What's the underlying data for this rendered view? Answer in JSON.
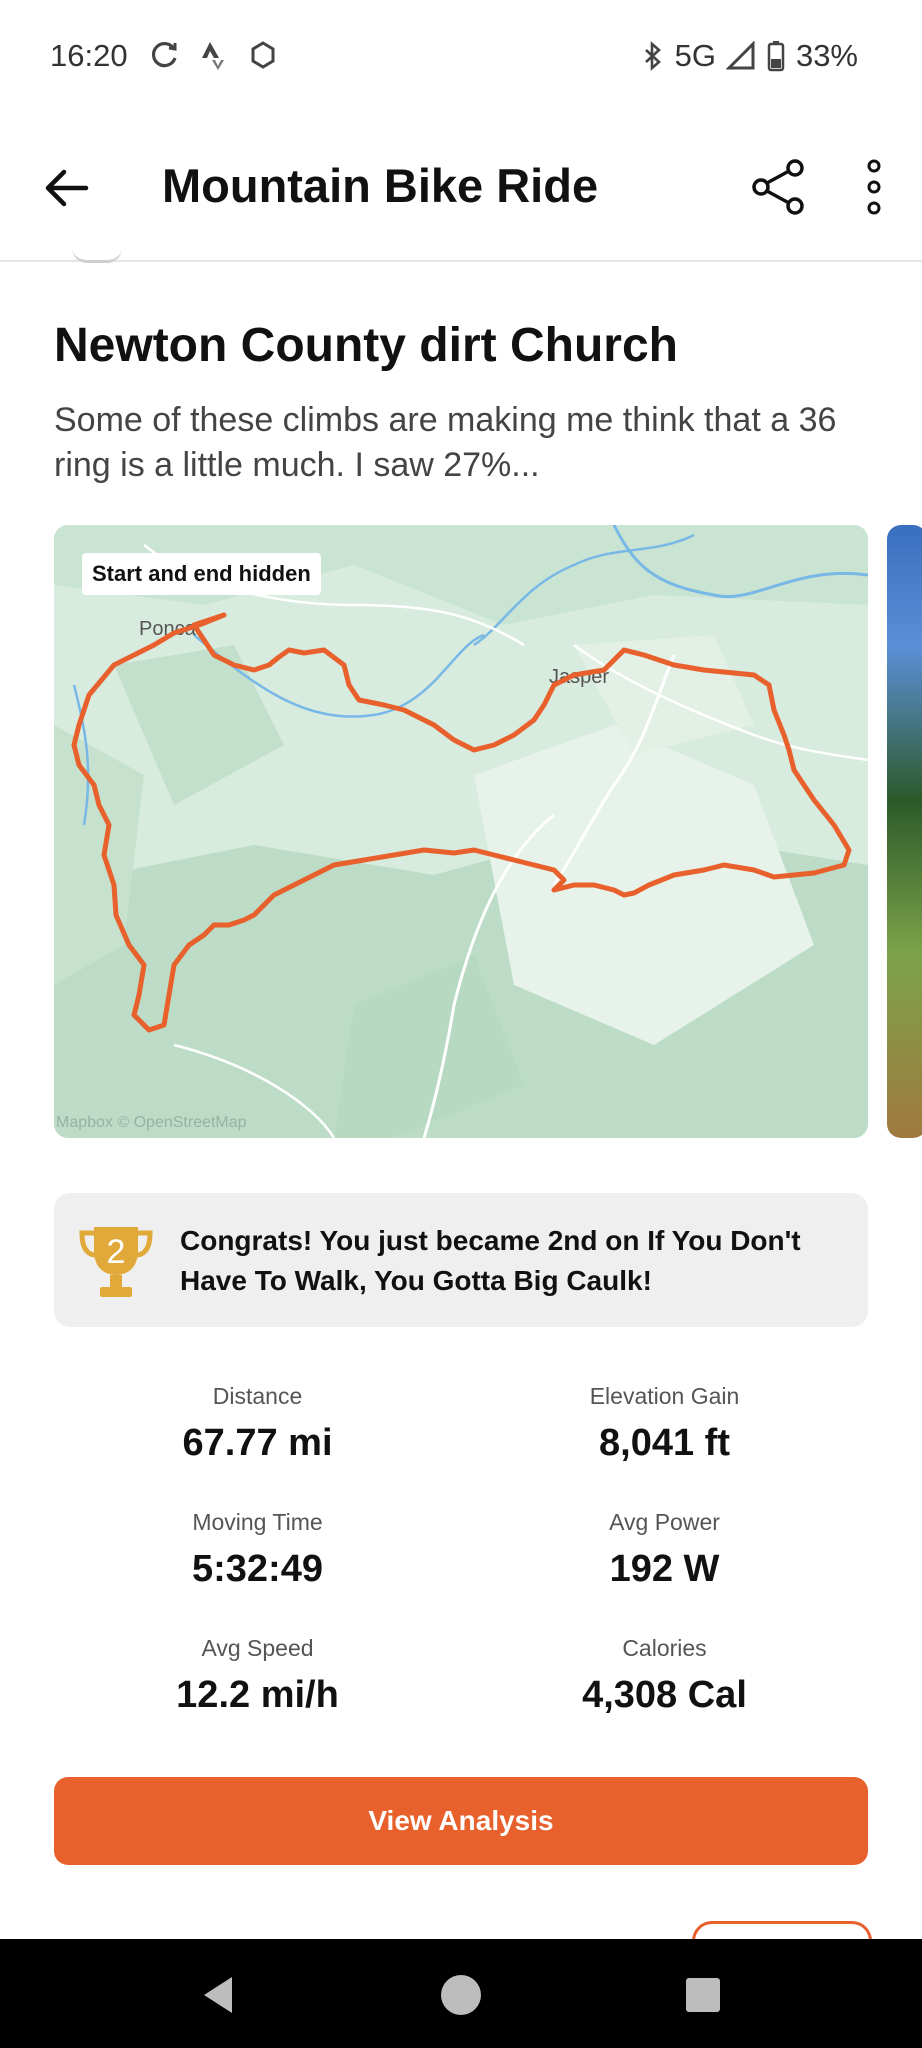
{
  "status_bar": {
    "time": "16:20",
    "network": "5G",
    "battery": "33%"
  },
  "app_bar": {
    "title": "Mountain Bike Ride",
    "back_icon": "arrow-left-icon",
    "share_icon": "share-icon",
    "more_icon": "more-vert-icon"
  },
  "activity": {
    "title": "Newton County dirt Church",
    "description": "Some of these climbs are making me think that a 36 ring is a little much. I saw 27%..."
  },
  "map": {
    "badge": "Start and end hidden",
    "labels": {
      "town1": "Ponca",
      "town2": "Jasper"
    },
    "attribution": "Mapbox © OpenStreetMap",
    "route_color": "#e8612c"
  },
  "achievement": {
    "icon": "trophy-icon",
    "rank": "2",
    "text": "Congrats! You just became 2nd on If You Don't Have To Walk, You Gotta Big Caulk!"
  },
  "stats": [
    {
      "label": "Distance",
      "value": "67.77 mi"
    },
    {
      "label": "Elevation Gain",
      "value": "8,041 ft"
    },
    {
      "label": "Moving Time",
      "value": "5:32:49"
    },
    {
      "label": "Avg Power",
      "value": "192 W"
    },
    {
      "label": "Avg Speed",
      "value": "12.2 mi/h"
    },
    {
      "label": "Calories",
      "value": "4,308 Cal"
    }
  ],
  "actions": {
    "view_analysis": "View Analysis"
  },
  "colors": {
    "accent": "#e8612c",
    "trophy": "#e0a93a"
  }
}
